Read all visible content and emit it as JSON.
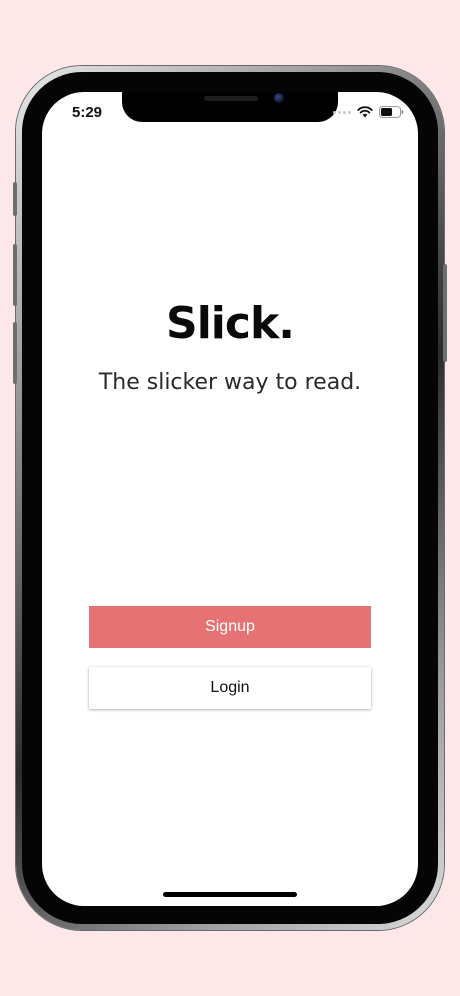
{
  "status_bar": {
    "time": "5:29",
    "icons": [
      "signal-dots-icon",
      "wifi-icon",
      "battery-icon"
    ]
  },
  "app": {
    "title": "Slick.",
    "tagline": "The slicker way to read."
  },
  "actions": {
    "signup_label": "Signup",
    "login_label": "Login"
  },
  "colors": {
    "background": "#fde7e9",
    "signup_button": "#e57373",
    "login_button": "#ffffff"
  }
}
